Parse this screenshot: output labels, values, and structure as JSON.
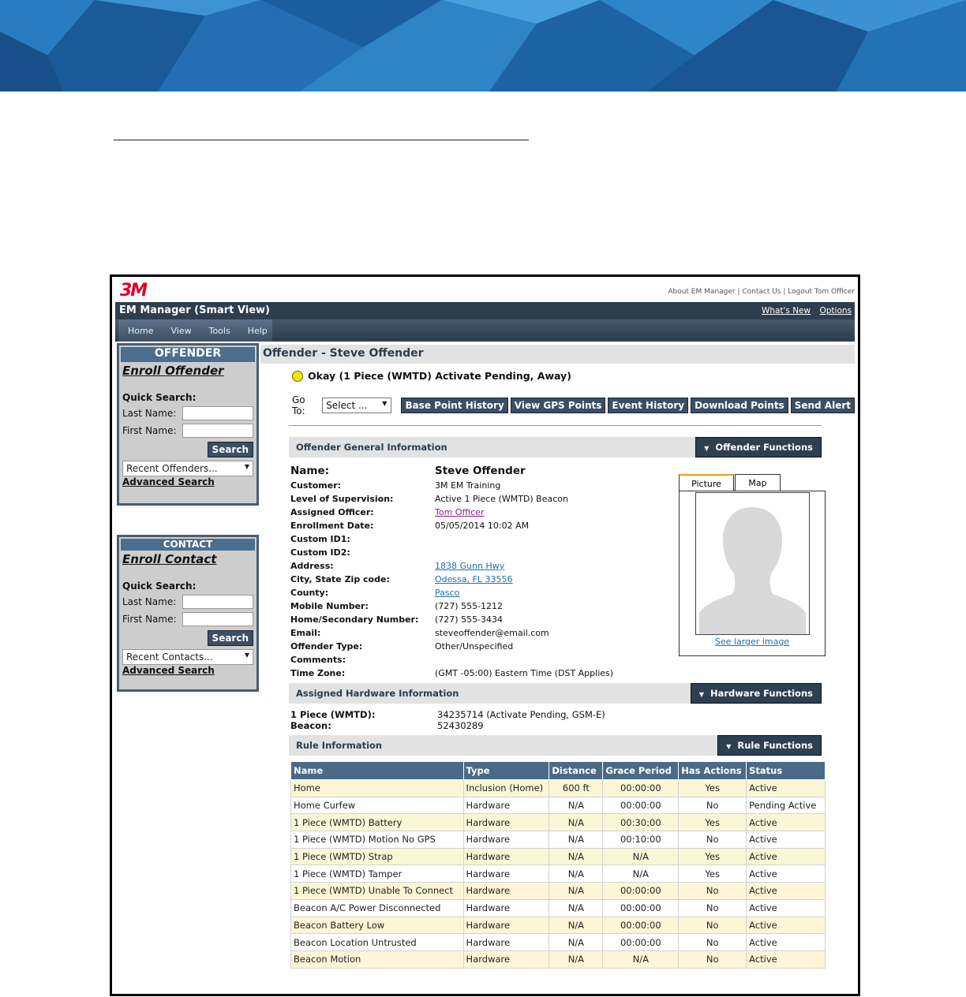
{
  "header": {
    "logo": "3M",
    "links": [
      "About EM Manager",
      "Contact Us",
      "Logout Tom Officer"
    ],
    "app_title": "EM Manager (Smart View)",
    "right_links": [
      "What's New",
      "Options"
    ],
    "menu": [
      "Home",
      "View",
      "Tools",
      "Help"
    ]
  },
  "offender_panel": {
    "heading": "OFFENDER",
    "enroll": "Enroll Offender",
    "quick_search": "Quick Search:",
    "last_name": "Last Name:",
    "first_name": "First Name:",
    "search": "Search",
    "recent": "Recent Offenders...",
    "advanced": "Advanced Search"
  },
  "contact_panel": {
    "heading": "CONTACT",
    "enroll": "Enroll Contact",
    "quick_search": "Quick Search:",
    "last_name": "Last Name:",
    "first_name": "First Name:",
    "search": "Search",
    "recent": "Recent Contacts...",
    "advanced": "Advanced Search"
  },
  "main": {
    "title": "Offender - Steve Offender",
    "status": "Okay (1 Piece (WMTD) Activate Pending, Away)",
    "status_color": "#f2e600",
    "goto_label": "Go To:",
    "goto_value": "Select ...",
    "actions": [
      "Base Point History",
      "View GPS Points",
      "Event History",
      "Download Points",
      "Send Alert"
    ]
  },
  "general": {
    "section": "Offender General Information",
    "functions": "Offender Functions",
    "name_label": "Name:",
    "name_value": "Steve Offender",
    "fields": [
      {
        "k": "Customer:",
        "v": "3M EM Training"
      },
      {
        "k": "Level of Supervision:",
        "v": "Active 1 Piece (WMTD) Beacon"
      },
      {
        "k": "Assigned Officer:",
        "v": "Tom Officer"
      },
      {
        "k": "Enrollment Date:",
        "v": "05/05/2014 10:02 AM"
      },
      {
        "k": "Custom ID1:",
        "v": ""
      },
      {
        "k": "Custom ID2:",
        "v": ""
      },
      {
        "k": "Address:",
        "v": "1838 Gunn Hwy"
      },
      {
        "k": "City, State Zip code:",
        "v": "Odessa, FL 33556"
      },
      {
        "k": "County:",
        "v": "Pasco"
      },
      {
        "k": "Mobile Number:",
        "v": "(727) 555-1212"
      },
      {
        "k": "Home/Secondary Number:",
        "v": "(727) 555-3434"
      },
      {
        "k": "Email:",
        "v": "steveoffender@email.com"
      },
      {
        "k": "Offender Type:",
        "v": "Other/Unspecified"
      },
      {
        "k": "Comments:",
        "v": ""
      },
      {
        "k": "Time Zone:",
        "v": "(GMT -05:00) Eastern Time (DST Applies)"
      }
    ],
    "tab_picture": "Picture",
    "tab_map": "Map",
    "larger_image": "See larger image"
  },
  "hardware": {
    "section": "Assigned Hardware Information",
    "functions": "Hardware Functions",
    "items": [
      {
        "k": "1 Piece (WMTD):",
        "v": "34235714 (Activate Pending, GSM-E)"
      },
      {
        "k": "Beacon:",
        "v": "52430289"
      }
    ]
  },
  "rules": {
    "section": "Rule Information",
    "functions": "Rule Functions",
    "columns": [
      "Name",
      "Type",
      "Distance",
      "Grace Period",
      "Has Actions",
      "Status"
    ],
    "rows": [
      [
        "Home",
        "Inclusion (Home)",
        "600 ft",
        "00:00:00",
        "Yes",
        "Active"
      ],
      [
        "Home Curfew",
        "Hardware",
        "N/A",
        "00:00:00",
        "No",
        "Pending Active"
      ],
      [
        "1 Piece (WMTD) Battery",
        "Hardware",
        "N/A",
        "00:30:00",
        "Yes",
        "Active"
      ],
      [
        "1 Piece (WMTD) Motion No GPS",
        "Hardware",
        "N/A",
        "00:10:00",
        "No",
        "Active"
      ],
      [
        "1 Piece (WMTD) Strap",
        "Hardware",
        "N/A",
        "N/A",
        "Yes",
        "Active"
      ],
      [
        "1 Piece (WMTD) Tamper",
        "Hardware",
        "N/A",
        "N/A",
        "Yes",
        "Active"
      ],
      [
        "1 Piece (WMTD) Unable To Connect",
        "Hardware",
        "N/A",
        "00:00:00",
        "No",
        "Active"
      ],
      [
        "Beacon A/C Power Disconnected",
        "Hardware",
        "N/A",
        "00:00:00",
        "No",
        "Active"
      ],
      [
        "Beacon Battery Low",
        "Hardware",
        "N/A",
        "00:00:00",
        "No",
        "Active"
      ],
      [
        "Beacon Location Untrusted",
        "Hardware",
        "N/A",
        "00:00:00",
        "No",
        "Active"
      ],
      [
        "Beacon Motion",
        "Hardware",
        "N/A",
        "N/A",
        "No",
        "Active"
      ]
    ]
  }
}
